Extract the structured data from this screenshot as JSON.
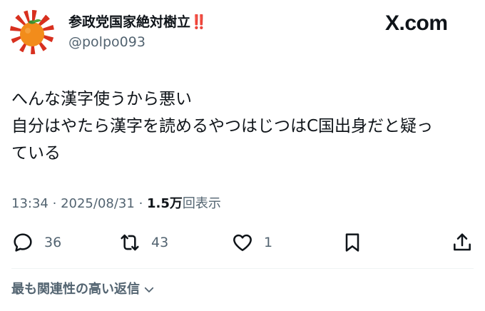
{
  "author": {
    "display_name": "参政党国家絶対樹立",
    "name_emoji": "‼️",
    "handle": "@polpo093",
    "avatar_icon": "orange-rising-sun-icon"
  },
  "brand": {
    "logo": "X.com"
  },
  "post": {
    "lines": [
      "へんな漢字使うから悪い",
      "自分はやたら漢字を読めるやつはじつはC国出身だと疑っ",
      "ている"
    ]
  },
  "meta": {
    "time": "13:34",
    "separator": "·",
    "date": "2025/08/31",
    "views_count": "1.5万",
    "views_label": "回表示"
  },
  "actions": {
    "replies": "36",
    "reposts": "43",
    "likes": "1"
  },
  "relevant_replies": {
    "label": "最も関連性の高い返信"
  },
  "colors": {
    "text": "#0f1419",
    "secondary": "#536471",
    "emoji_red": "#e0242a",
    "avatar_orange": "#f28c1b",
    "avatar_ray_red": "#d8301f"
  }
}
